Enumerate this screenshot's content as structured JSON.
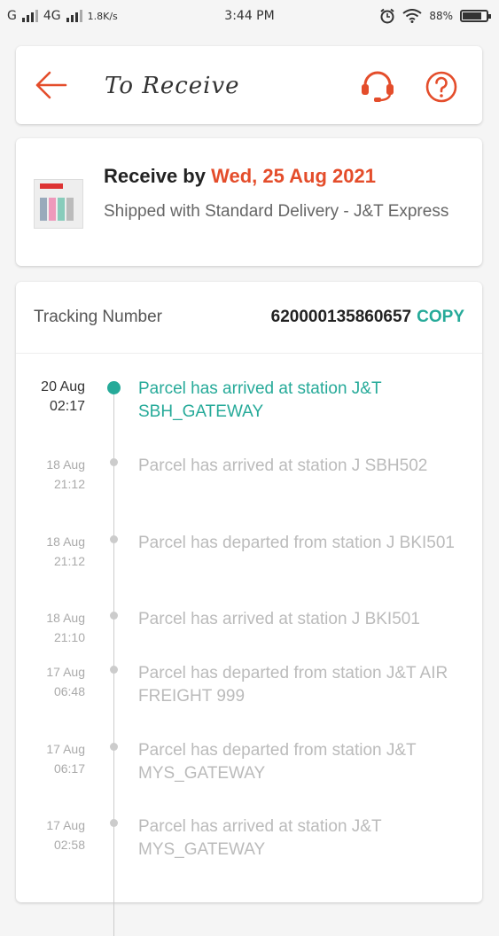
{
  "status_bar": {
    "carrier_left": "G",
    "network": "4G",
    "speed": "1.8K/s",
    "time": "3:44 PM",
    "battery": "88%",
    "battery_level": 0.88
  },
  "header": {
    "title": "To Receive"
  },
  "delivery": {
    "receive_label": "Receive by",
    "receive_date": "Wed, 25 Aug 2021",
    "shipping_info": "Shipped with Standard Delivery  - J&T Express"
  },
  "tracking": {
    "label": "Tracking Number",
    "number": "620000135860657",
    "copy_label": "COPY",
    "events": [
      {
        "date": "20 Aug",
        "time": "02:17",
        "text": "Parcel has arrived at station J&T SBH_GATEWAY"
      },
      {
        "date": "18 Aug",
        "time": "21:12",
        "text": "Parcel has arrived at station J SBH502"
      },
      {
        "date": "18 Aug",
        "time": "21:12",
        "text": "Parcel has departed from station J BKI501"
      },
      {
        "date": "18 Aug",
        "time": "21:10",
        "text": "Parcel has arrived at station J BKI501"
      },
      {
        "date": "17 Aug",
        "time": "06:48",
        "text": "Parcel has departed from station J&T AIR FREIGHT 999"
      },
      {
        "date": "17 Aug",
        "time": "06:17",
        "text": "Parcel has departed from station J&T MYS_GATEWAY"
      },
      {
        "date": "17 Aug",
        "time": "02:58",
        "text": "Parcel has arrived at station J&T MYS_GATEWAY"
      }
    ]
  },
  "colors": {
    "accent": "#e44d2b",
    "teal": "#26aa99"
  },
  "icons": {
    "back": "back-arrow-icon",
    "support": "headset-icon",
    "help": "help-circle-icon"
  }
}
